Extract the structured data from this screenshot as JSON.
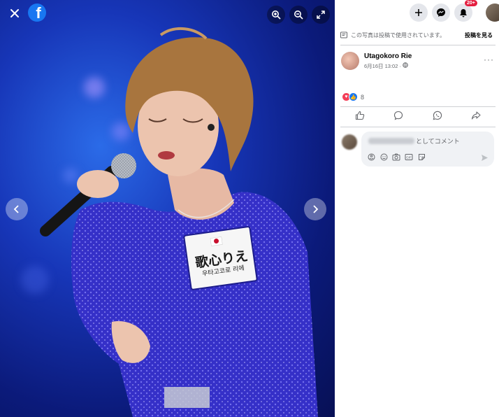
{
  "viewer": {
    "close_icon": "close-icon",
    "logo_icon": "facebook-logo-icon",
    "zoom_in_icon": "zoom-in-icon",
    "zoom_out_icon": "zoom-out-icon",
    "fullscreen_icon": "fullscreen-icon",
    "prev_icon": "chevron-left-icon",
    "next_icon": "chevron-right-icon",
    "photo_text": {
      "name_tag_line1": "歌心りえ",
      "name_tag_line2": "우타고코로 리에"
    },
    "background_color": "#1736b8"
  },
  "topbar": {
    "create_icon": "plus-icon",
    "messenger_icon": "messenger-icon",
    "notifications_icon": "bell-icon",
    "notifications_badge": "20+",
    "account_icon": "avatar"
  },
  "notice": {
    "text": "この写真は投稿で使用されています。",
    "see_post": "投稿を見る"
  },
  "post": {
    "author": "Utagokoro Rie",
    "date": "6月16日 13:02",
    "audience_icon": "globe-icon",
    "more": "···",
    "reaction_count": "8",
    "actions": [
      "like-icon",
      "comment-icon",
      "whatsapp-icon",
      "share-icon"
    ]
  },
  "comment": {
    "placeholder_suffix": "としてコメント",
    "tools": [
      "avatar-sticker-icon",
      "emoji-icon",
      "camera-icon",
      "gif-icon",
      "sticker-icon"
    ],
    "send_icon": "send-icon"
  },
  "colors": {
    "brand": "#1877f2",
    "badge": "#e41e3f",
    "muted": "#65676b"
  }
}
